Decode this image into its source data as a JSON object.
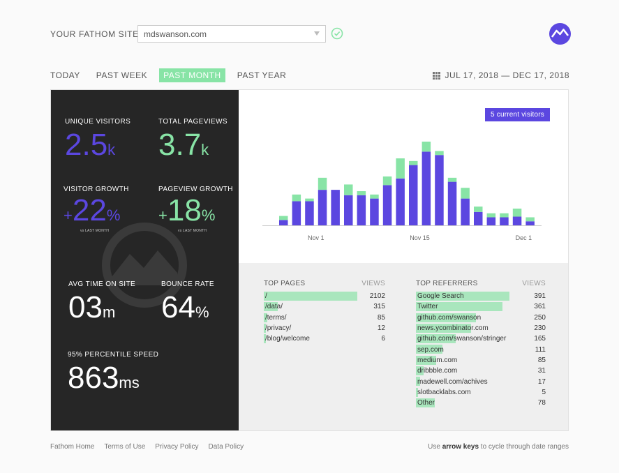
{
  "header": {
    "site_label": "YOUR FATHOM SITES",
    "site_value": "mdswanson.com"
  },
  "tabs": [
    {
      "label": "TODAY",
      "active": false
    },
    {
      "label": "PAST WEEK",
      "active": false
    },
    {
      "label": "PAST MONTH",
      "active": true
    },
    {
      "label": "PAST YEAR",
      "active": false
    }
  ],
  "date_range": "JUL 17, 2018 — DEC 17, 2018",
  "stats": {
    "unique_visitors": {
      "label": "UNIQUE VISITORS",
      "value": "2.5",
      "unit": "k"
    },
    "total_pageviews": {
      "label": "TOTAL PAGEVIEWS",
      "value": "3.7",
      "unit": "k"
    },
    "visitor_growth": {
      "label": "VISITOR GROWTH",
      "sign": "+",
      "value": "22",
      "unit": "%",
      "sub": "vs LAST MONTH"
    },
    "pageview_growth": {
      "label": "PAGEVIEW GROWTH",
      "sign": "+",
      "value": "18",
      "unit": "%",
      "sub": "vs LAST MONTH"
    },
    "avg_time": {
      "label": "AVG TIME ON SITE",
      "value": "03",
      "unit": "m"
    },
    "bounce_rate": {
      "label": "BOUNCE RATE",
      "value": "64",
      "unit": "%"
    },
    "percentile_speed": {
      "label": "95% PERCENTILE SPEED",
      "value": "863",
      "unit": "ms"
    }
  },
  "current_visitors": "5 current visitors",
  "chart_data": {
    "type": "bar",
    "stacked": true,
    "tick_labels": [
      {
        "label": "Nov 1",
        "index": 2.5
      },
      {
        "label": "Nov 15",
        "index": 10.5
      },
      {
        "label": "Dec 1",
        "index": 18.5
      }
    ],
    "series": [
      {
        "values": [
          8,
          36,
          36,
          53,
          53,
          45,
          45,
          40,
          60,
          70,
          90,
          110,
          105,
          65,
          40,
          20,
          12,
          12,
          13,
          6
        ]
      },
      {
        "values": [
          6,
          10,
          4,
          18,
          0,
          16,
          6,
          6,
          13,
          30,
          6,
          15,
          6,
          6,
          16,
          8,
          6,
          6,
          12,
          6
        ]
      }
    ],
    "ylim": [
      0,
      150
    ],
    "colors": [
      "#5b47e0",
      "#88e4a6"
    ]
  },
  "top_pages": {
    "title": "TOP PAGES",
    "col": "VIEWS",
    "max": 2102,
    "rows": [
      {
        "label": "/",
        "value": 2102
      },
      {
        "label": "/data/",
        "value": 315
      },
      {
        "label": "/terms/",
        "value": 85
      },
      {
        "label": "/privacy/",
        "value": 12
      },
      {
        "label": "/blog/welcome",
        "value": 6
      }
    ]
  },
  "top_referrers": {
    "title": "TOP REFERRERS",
    "col": "VIEWS",
    "max": 391,
    "rows": [
      {
        "label": "Google Search",
        "value": 391
      },
      {
        "label": "Twitter",
        "value": 361
      },
      {
        "label": "github.com/swanson",
        "value": 250
      },
      {
        "label": "news.ycombinator.com",
        "value": 230
      },
      {
        "label": "github.com/swanson/stringer",
        "value": 165
      },
      {
        "label": "sep.com",
        "value": 111
      },
      {
        "label": "medium.com",
        "value": 85
      },
      {
        "label": "dribbble.com",
        "value": 31
      },
      {
        "label": "madewell.com/achives",
        "value": 17
      },
      {
        "label": "slotbacklabs.com",
        "value": 5
      },
      {
        "label": "Other",
        "value": 78
      }
    ]
  },
  "footer": {
    "links": [
      "Fathom Home",
      "Terms of Use",
      "Privacy Policy",
      "Data Policy"
    ],
    "hint_pre": "Use",
    "hint_keys": "arrow keys",
    "hint_post": "to cycle through date ranges"
  }
}
